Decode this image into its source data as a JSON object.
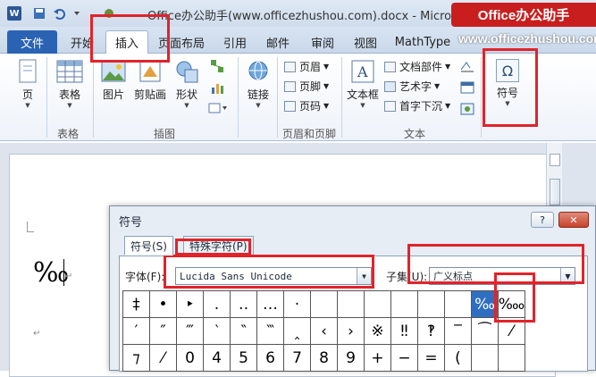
{
  "title_bar": {
    "logo": "W",
    "save_icon": "save-icon",
    "title": "Office办公助手(www.officezhushou.com).docx - Microsoft",
    "brand": "Office办公助手"
  },
  "watermark_url": "www.officezhushou.com",
  "tabs": [
    "文件",
    "开始",
    "插入",
    "页面布局",
    "引用",
    "邮件",
    "审阅",
    "视图",
    "MathType"
  ],
  "ribbon": {
    "page": "页",
    "table": "表格",
    "picture": "图片",
    "clipart": "剪贴画",
    "shapes": "形状",
    "link": "链接",
    "header": "页眉",
    "footer": "页脚",
    "page_number": "页码",
    "textbox": "文本框",
    "quickparts": "文档部件",
    "wordart": "艺术字",
    "dropcap": "首字下沉",
    "symbol": "符号",
    "symbol_glyph": "Ω",
    "groups": {
      "table": "表格",
      "illustrations": "插图",
      "header_footer": "页眉和页脚",
      "text": "文本"
    }
  },
  "document": {
    "text": "‰",
    "para_mark": "↵"
  },
  "dialog": {
    "title": "符号",
    "help": "?",
    "close": "✕",
    "tab_symbols": "符号(S)",
    "tab_special": "特殊字符(P)",
    "font_label": "字体(F):",
    "font_value": "Lucida Sans Unicode",
    "subset_label": "子集(U):",
    "subset_value": "广义标点",
    "symbols": [
      [
        "‡",
        "•",
        "‣",
        "․",
        "‥",
        "…",
        "‧",
        "",
        "",
        "",
        "",
        "",
        "",
        "‰",
        "‱"
      ],
      [
        "′",
        "″",
        "‴",
        "‵",
        "‶",
        "‷",
        "‸",
        "‹",
        "›",
        "※",
        "‼",
        "‽",
        "‾",
        "⁀",
        "⁄"
      ],
      [
        "⁊",
        "⁄",
        "0",
        "4",
        "5",
        "6",
        "7",
        "8",
        "9",
        "+",
        "−",
        "=",
        "(",
        "",
        ""
      ]
    ],
    "selected": "‰"
  },
  "colors": {
    "accent": "#2b63b4",
    "highlight": "#e2232a",
    "brand": "#c81e1e"
  }
}
